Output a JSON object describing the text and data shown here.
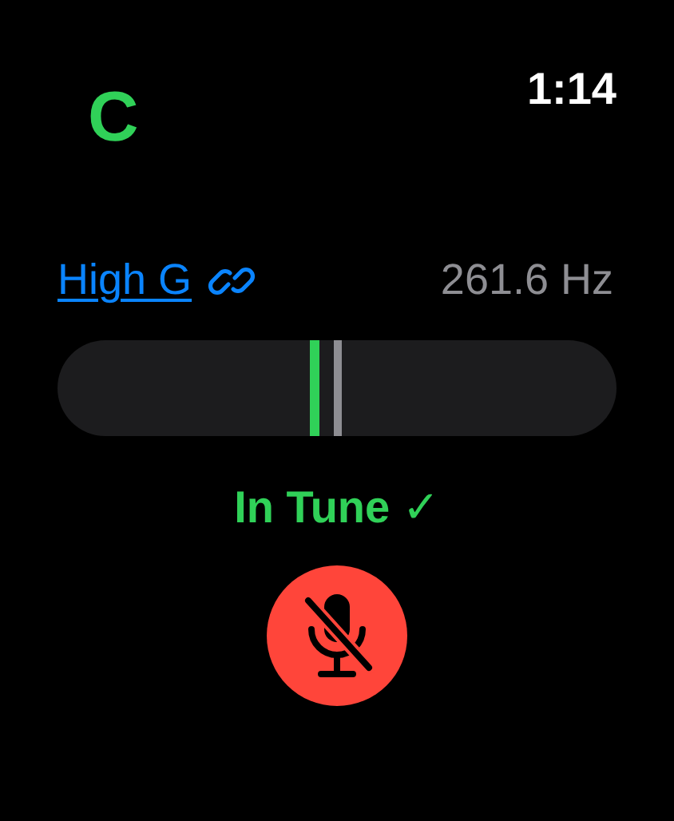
{
  "status_bar": {
    "time": "1:14"
  },
  "note": "C",
  "target": {
    "label": "High G",
    "linked": true
  },
  "frequency": "261.6 Hz",
  "meter": {
    "level": 0.46
  },
  "tuning_status": "In Tune ✓",
  "mic_button": {
    "muted": true
  }
}
